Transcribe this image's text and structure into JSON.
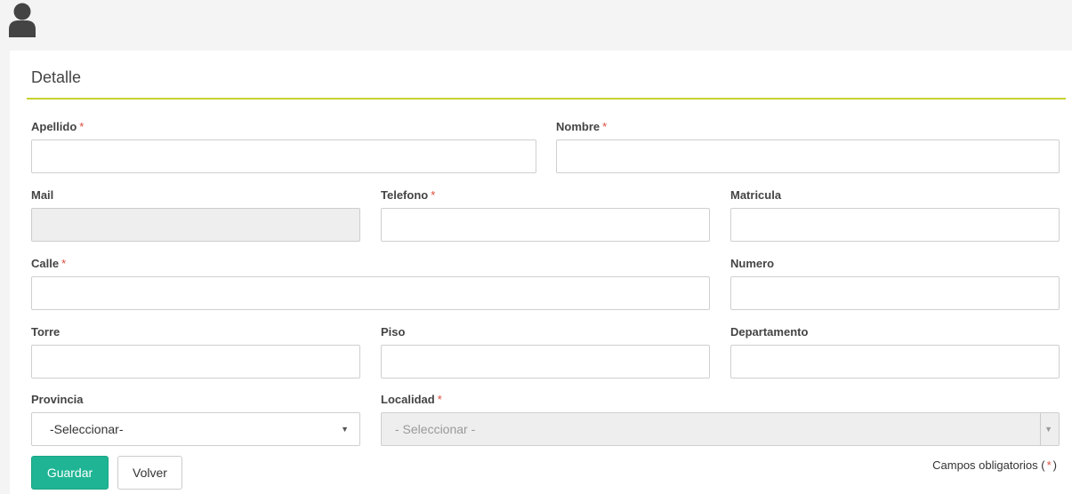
{
  "header": {
    "avatar_icon": "user-icon"
  },
  "panel": {
    "title": "Detalle",
    "accent_color": "#c6d22e"
  },
  "form": {
    "required_marker": "*",
    "apellido": {
      "label": "Apellido",
      "value": ""
    },
    "nombre": {
      "label": "Nombre",
      "value": ""
    },
    "mail": {
      "label": "Mail",
      "value": ""
    },
    "telefono": {
      "label": "Telefono",
      "value": ""
    },
    "matricula": {
      "label": "Matricula",
      "value": ""
    },
    "calle": {
      "label": "Calle",
      "value": ""
    },
    "numero": {
      "label": "Numero",
      "value": ""
    },
    "torre": {
      "label": "Torre",
      "value": ""
    },
    "piso": {
      "label": "Piso",
      "value": ""
    },
    "departamento": {
      "label": "Departamento",
      "value": ""
    },
    "provincia": {
      "label": "Provincia",
      "selected": "-Seleccionar-"
    },
    "localidad": {
      "label": "Localidad",
      "selected": "- Seleccionar -"
    }
  },
  "actions": {
    "save_label": "Guardar",
    "back_label": "Volver",
    "primary_color": "#1fb594"
  },
  "footnote": {
    "text": "Campos obligatorios (",
    "marker": "*",
    "close": ")"
  }
}
